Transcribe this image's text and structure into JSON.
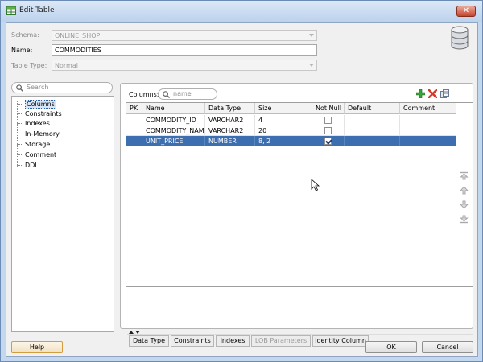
{
  "window": {
    "title": "Edit Table"
  },
  "form": {
    "schema_label": "Schema:",
    "schema_value": "ONLINE_SHOP",
    "name_label": "Name:",
    "name_value": "COMMODITIES",
    "table_type_label": "Table Type:",
    "table_type_value": "Normal"
  },
  "nav": {
    "search_placeholder": "Search",
    "items": [
      {
        "label": "Columns",
        "selected": true
      },
      {
        "label": "Constraints"
      },
      {
        "label": "Indexes"
      },
      {
        "label": "In-Memory"
      },
      {
        "label": "Storage"
      },
      {
        "label": "Comment"
      },
      {
        "label": "DDL"
      }
    ]
  },
  "columns_panel": {
    "label": "Columns:",
    "filter_placeholder": "name",
    "headers": [
      "PK",
      "Name",
      "Data Type",
      "Size",
      "Not Null",
      "Default",
      "Comment"
    ],
    "rows": [
      {
        "pk": "",
        "name": "COMMODITY_ID",
        "type": "VARCHAR2",
        "size": "4",
        "not_null": false,
        "default": "",
        "comment": ""
      },
      {
        "pk": "",
        "name": "COMMODITY_NAME",
        "type": "VARCHAR2",
        "size": "20",
        "not_null": false,
        "default": "",
        "comment": ""
      },
      {
        "pk": "",
        "name": "UNIT_PRICE",
        "type": "NUMBER",
        "size": "8, 2",
        "not_null": true,
        "default": "",
        "comment": "",
        "selected": true
      }
    ],
    "sub_tabs": [
      "Data Type",
      "Constraints",
      "Indexes",
      "LOB Parameters",
      "Identity Column"
    ]
  },
  "buttons": {
    "help": "Help",
    "ok": "OK",
    "cancel": "Cancel"
  },
  "colors": {
    "accent": "#3d6fb0",
    "add": "#3aa23a",
    "delete": "#d23a2a"
  }
}
